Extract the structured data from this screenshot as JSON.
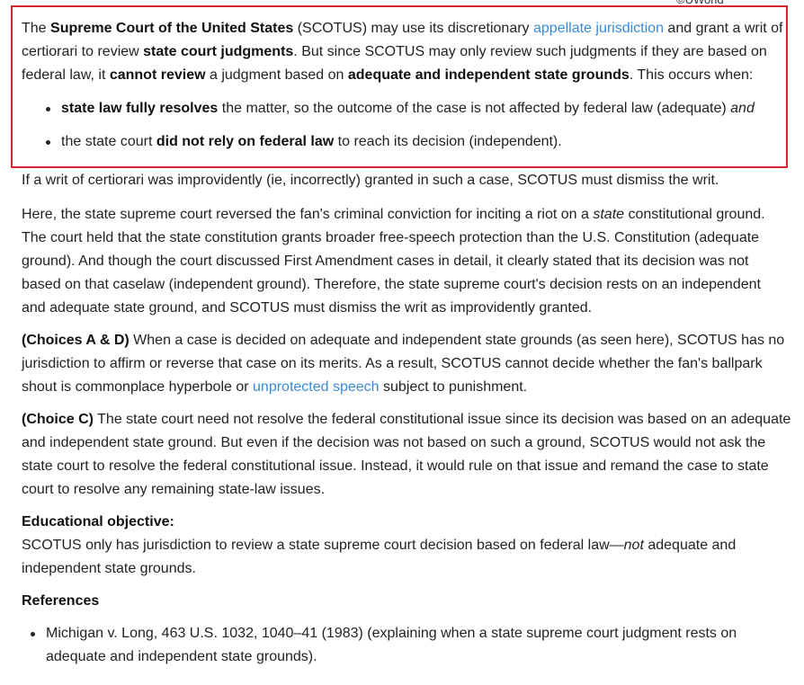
{
  "watermark": "©UWorld",
  "intro": {
    "t1": "The ",
    "b1": "Supreme Court of the United States",
    "t2": " (SCOTUS) may use its discretionary ",
    "link1": "appellate jurisdiction",
    "t3": " and grant a writ of certiorari to review ",
    "b2": "state court judgments",
    "t4": ".  But since SCOTUS may only review such judgments if they are based on federal law, it ",
    "b3": "cannot review",
    "t5": " a judgment based on ",
    "b4": "adequate and independent state grounds",
    "t6": ".  This occurs when:"
  },
  "bullets": [
    {
      "bold": "state law fully resolves",
      "text": " the matter, so the outcome of the case is not affected by federal law (adequate) ",
      "italic": "and"
    },
    {
      "pre": "the state court ",
      "bold": "did not rely on federal law",
      "text": " to reach its decision (independent)."
    }
  ],
  "para_dismiss": "If a writ of certiorari was improvidently (ie, incorrectly) granted in such a case, SCOTUS must dismiss the writ.",
  "para_here": {
    "t1": "Here, the state supreme court reversed the fan's criminal conviction for inciting a riot on a ",
    "i1": "state",
    "t2": " constitutional ground.  The court held that the state constitution grants broader free-speech protection than the U.S. Constitution (adequate ground).  And though the court discussed First Amendment cases in detail, it clearly stated that its decision was not based on that caselaw (independent ground).  Therefore, the state supreme court's decision rests on an independent and adequate state ground, and SCOTUS must dismiss the writ as improvidently granted."
  },
  "choice_ad": {
    "label": "(Choices A & D)",
    "t1": "  When a case is decided on adequate and independent state grounds (as seen here), SCOTUS has no jurisdiction to affirm or reverse that case on its merits.  As a result, SCOTUS cannot decide whether the fan's ballpark shout is commonplace hyperbole or ",
    "link": "unprotected speech",
    "t2": " subject to punishment."
  },
  "choice_c": {
    "label": "(Choice C)",
    "t1": "  The state court need not resolve the federal constitutional issue since its decision was based on an adequate and independent state ground.  But even if the decision was not based on such a ground, SCOTUS would not ask the state court to resolve the federal constitutional issue.  Instead, it would rule on that issue and remand the case to state court to resolve any remaining state-law issues."
  },
  "objective": {
    "heading": "Educational objective:",
    "t1": "SCOTUS only has jurisdiction to review a state supreme court decision based on federal law—",
    "i1": "not",
    "t2": " adequate and independent state grounds."
  },
  "references": {
    "heading": "References",
    "items": [
      "Michigan v. Long, 463 U.S. 1032, 1040–41 (1983) (explaining when a state supreme court judgment rests on adequate and independent state grounds)."
    ]
  },
  "colors": {
    "link": "#3a8bd8",
    "highlight_border": "#d9262e",
    "text": "#222222"
  }
}
